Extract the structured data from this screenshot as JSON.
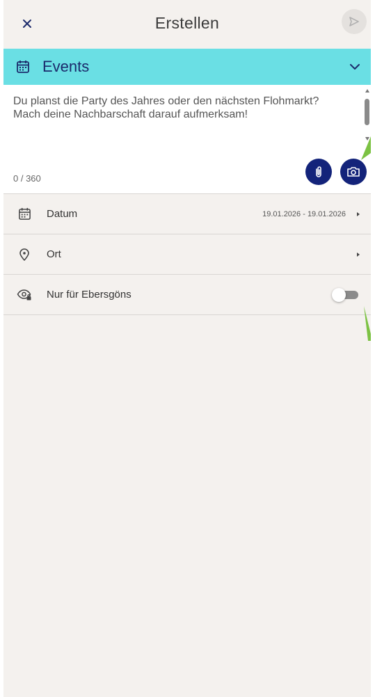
{
  "header": {
    "title": "Erstellen",
    "close_icon": "close-icon",
    "send_icon": "send-icon"
  },
  "category": {
    "label": "Events",
    "icon": "calendar-icon",
    "expand_icon": "chevron-down-icon"
  },
  "compose": {
    "text": "Du planst die Party des Jahres oder den nächsten Flohmarkt? Mach deine Nachbarschaft darauf aufmerksam!",
    "char_count": "0 / 360",
    "attach_icon": "paperclip-icon",
    "camera_icon": "camera-icon"
  },
  "rows": {
    "date": {
      "label": "Datum",
      "value": "19.01.2026 - 19.01.2026",
      "icon": "calendar-icon"
    },
    "location": {
      "label": "Ort",
      "icon": "location-pin-icon"
    },
    "visibility": {
      "label": "Nur für Ebersgöns",
      "icon": "eye-lock-icon",
      "toggle_on": false
    }
  },
  "colors": {
    "accent": "#6adfe4",
    "primary": "#13237a",
    "background": "#f4f1ee",
    "tutorial_arrow": "#7cc243"
  }
}
